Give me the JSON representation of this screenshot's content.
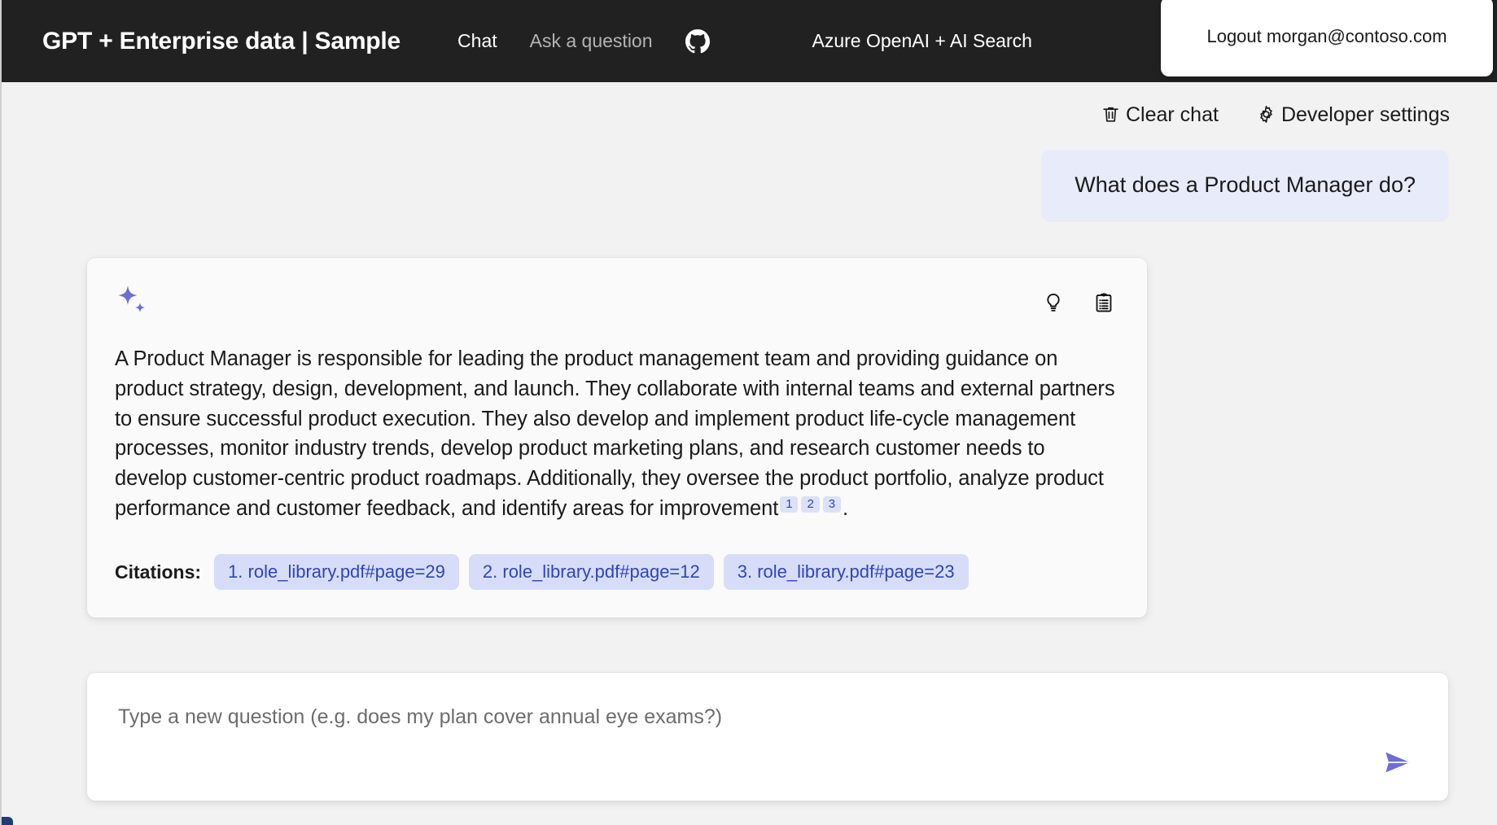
{
  "header": {
    "title": "GPT + Enterprise data | Sample",
    "nav": [
      {
        "label": "Chat",
        "active": true
      },
      {
        "label": "Ask a question",
        "active": false
      }
    ],
    "github_icon": "github-icon",
    "brand": "Azure OpenAI + AI Search",
    "logout_label": "Logout morgan@contoso.com"
  },
  "command_bar": {
    "clear_chat": {
      "label": "Clear chat",
      "icon": "trash-icon"
    },
    "developer_settings": {
      "label": "Developer settings",
      "icon": "gear-icon"
    }
  },
  "chat": {
    "user_message": "What does a Product Manager do?",
    "answer": {
      "icon": "sparkle-icon",
      "actions": [
        {
          "name": "thought-process",
          "icon": "lightbulb-icon"
        },
        {
          "name": "supporting-content",
          "icon": "clipboard-icon"
        }
      ],
      "text_part_1": "A Product Manager is responsible for leading the product management team and providing guidance on product strategy, design, development, and launch. They collaborate with internal teams and external partners to ensure successful product execution. They also develop and implement product life-cycle management processes, monitor industry trends, develop product marketing plans, and research customer needs to develop customer-centric product roadmaps. Additionally, they oversee the product portfolio, analyze product performance and customer feedback, and identify areas for improvement",
      "superscripts": [
        "1",
        "2",
        "3"
      ],
      "text_part_2": ".",
      "citations_label": "Citations:",
      "citations": [
        "1. role_library.pdf#page=29",
        "2. role_library.pdf#page=12",
        "3. role_library.pdf#page=23"
      ]
    }
  },
  "question_input": {
    "placeholder": "Type a new question (e.g. does my plan cover annual eye exams?)",
    "value": "",
    "send_icon": "send-icon"
  },
  "colors": {
    "header_bg": "#212121",
    "page_bg": "#f2f2f2",
    "user_bubble_bg": "#e8ebfa",
    "accent_purple": "#6b6ed4",
    "citation_blue": "#2f45b8",
    "citation_chip_bg": "#d7ddf8"
  }
}
